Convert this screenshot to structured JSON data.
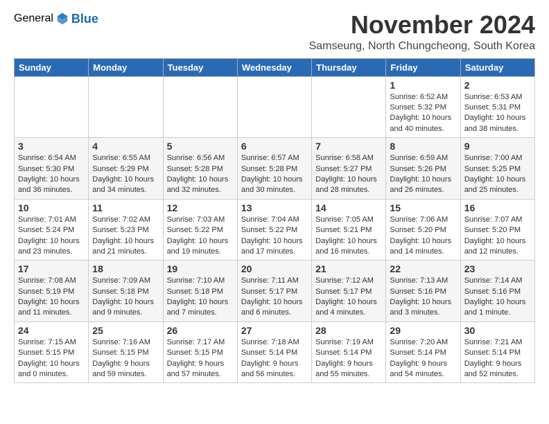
{
  "header": {
    "logo_general": "General",
    "logo_blue": "Blue",
    "month_title": "November 2024",
    "subtitle": "Samseung, North Chungcheong, South Korea"
  },
  "weekdays": [
    "Sunday",
    "Monday",
    "Tuesday",
    "Wednesday",
    "Thursday",
    "Friday",
    "Saturday"
  ],
  "weeks": [
    [
      {
        "day": "",
        "info": ""
      },
      {
        "day": "",
        "info": ""
      },
      {
        "day": "",
        "info": ""
      },
      {
        "day": "",
        "info": ""
      },
      {
        "day": "",
        "info": ""
      },
      {
        "day": "1",
        "info": "Sunrise: 6:52 AM\nSunset: 5:32 PM\nDaylight: 10 hours and 40 minutes."
      },
      {
        "day": "2",
        "info": "Sunrise: 6:53 AM\nSunset: 5:31 PM\nDaylight: 10 hours and 38 minutes."
      }
    ],
    [
      {
        "day": "3",
        "info": "Sunrise: 6:54 AM\nSunset: 5:30 PM\nDaylight: 10 hours and 36 minutes."
      },
      {
        "day": "4",
        "info": "Sunrise: 6:55 AM\nSunset: 5:29 PM\nDaylight: 10 hours and 34 minutes."
      },
      {
        "day": "5",
        "info": "Sunrise: 6:56 AM\nSunset: 5:28 PM\nDaylight: 10 hours and 32 minutes."
      },
      {
        "day": "6",
        "info": "Sunrise: 6:57 AM\nSunset: 5:28 PM\nDaylight: 10 hours and 30 minutes."
      },
      {
        "day": "7",
        "info": "Sunrise: 6:58 AM\nSunset: 5:27 PM\nDaylight: 10 hours and 28 minutes."
      },
      {
        "day": "8",
        "info": "Sunrise: 6:59 AM\nSunset: 5:26 PM\nDaylight: 10 hours and 26 minutes."
      },
      {
        "day": "9",
        "info": "Sunrise: 7:00 AM\nSunset: 5:25 PM\nDaylight: 10 hours and 25 minutes."
      }
    ],
    [
      {
        "day": "10",
        "info": "Sunrise: 7:01 AM\nSunset: 5:24 PM\nDaylight: 10 hours and 23 minutes."
      },
      {
        "day": "11",
        "info": "Sunrise: 7:02 AM\nSunset: 5:23 PM\nDaylight: 10 hours and 21 minutes."
      },
      {
        "day": "12",
        "info": "Sunrise: 7:03 AM\nSunset: 5:22 PM\nDaylight: 10 hours and 19 minutes."
      },
      {
        "day": "13",
        "info": "Sunrise: 7:04 AM\nSunset: 5:22 PM\nDaylight: 10 hours and 17 minutes."
      },
      {
        "day": "14",
        "info": "Sunrise: 7:05 AM\nSunset: 5:21 PM\nDaylight: 10 hours and 16 minutes."
      },
      {
        "day": "15",
        "info": "Sunrise: 7:06 AM\nSunset: 5:20 PM\nDaylight: 10 hours and 14 minutes."
      },
      {
        "day": "16",
        "info": "Sunrise: 7:07 AM\nSunset: 5:20 PM\nDaylight: 10 hours and 12 minutes."
      }
    ],
    [
      {
        "day": "17",
        "info": "Sunrise: 7:08 AM\nSunset: 5:19 PM\nDaylight: 10 hours and 11 minutes."
      },
      {
        "day": "18",
        "info": "Sunrise: 7:09 AM\nSunset: 5:18 PM\nDaylight: 10 hours and 9 minutes."
      },
      {
        "day": "19",
        "info": "Sunrise: 7:10 AM\nSunset: 5:18 PM\nDaylight: 10 hours and 7 minutes."
      },
      {
        "day": "20",
        "info": "Sunrise: 7:11 AM\nSunset: 5:17 PM\nDaylight: 10 hours and 6 minutes."
      },
      {
        "day": "21",
        "info": "Sunrise: 7:12 AM\nSunset: 5:17 PM\nDaylight: 10 hours and 4 minutes."
      },
      {
        "day": "22",
        "info": "Sunrise: 7:13 AM\nSunset: 5:16 PM\nDaylight: 10 hours and 3 minutes."
      },
      {
        "day": "23",
        "info": "Sunrise: 7:14 AM\nSunset: 5:16 PM\nDaylight: 10 hours and 1 minute."
      }
    ],
    [
      {
        "day": "24",
        "info": "Sunrise: 7:15 AM\nSunset: 5:15 PM\nDaylight: 10 hours and 0 minutes."
      },
      {
        "day": "25",
        "info": "Sunrise: 7:16 AM\nSunset: 5:15 PM\nDaylight: 9 hours and 59 minutes."
      },
      {
        "day": "26",
        "info": "Sunrise: 7:17 AM\nSunset: 5:15 PM\nDaylight: 9 hours and 57 minutes."
      },
      {
        "day": "27",
        "info": "Sunrise: 7:18 AM\nSunset: 5:14 PM\nDaylight: 9 hours and 56 minutes."
      },
      {
        "day": "28",
        "info": "Sunrise: 7:19 AM\nSunset: 5:14 PM\nDaylight: 9 hours and 55 minutes."
      },
      {
        "day": "29",
        "info": "Sunrise: 7:20 AM\nSunset: 5:14 PM\nDaylight: 9 hours and 54 minutes."
      },
      {
        "day": "30",
        "info": "Sunrise: 7:21 AM\nSunset: 5:14 PM\nDaylight: 9 hours and 52 minutes."
      }
    ]
  ]
}
